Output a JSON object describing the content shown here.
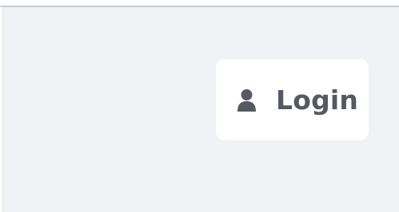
{
  "login_button": {
    "label": "Login",
    "icon": "user-icon"
  },
  "colors": {
    "background": "#f0f2f5",
    "button_background": "#ffffff",
    "text": "#555a62",
    "icon": "#555a62"
  }
}
